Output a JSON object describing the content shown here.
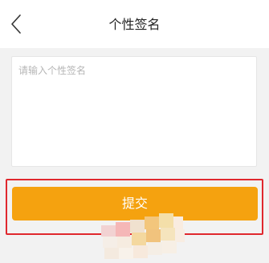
{
  "header": {
    "title": "个性签名",
    "back_icon": "chevron-left-icon"
  },
  "signature": {
    "value": "",
    "placeholder": "请输入个性签名"
  },
  "submit": {
    "label": "提交",
    "color": "#f5a20f"
  },
  "colors": {
    "highlight_border": "#e0282e",
    "page_background": "#f2f2f2"
  }
}
